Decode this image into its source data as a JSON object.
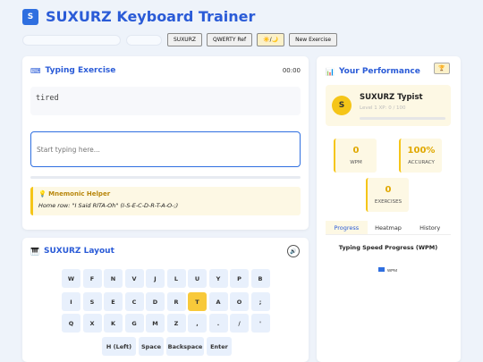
{
  "header": {
    "logo_letter": "S",
    "title": "SUXURZ Keyboard Trainer"
  },
  "toolbar": {
    "buttons": [
      "SUXURZ",
      "QWERTY Ref",
      "☀️/🌙",
      "New Exercise"
    ]
  },
  "exercise": {
    "icon": "keyboard-icon",
    "title": "Typing Exercise",
    "timer": "00:00",
    "text": "tired",
    "input_value": "",
    "input_placeholder": "Start typing here...",
    "progress": 0,
    "mnemonic_title": "Mnemonic Helper",
    "mnemonic_text": "Home row: \"I Said RITA-Oh\" (I-S-E-C-D-R-T-A-O-;)"
  },
  "layout": {
    "icon": "piano-icon",
    "title": "SUXURZ Layout",
    "sound_icon": "speaker-icon",
    "rows": [
      [
        "W",
        "F",
        "N",
        "V",
        "J",
        "L",
        "U",
        "Y",
        "P",
        "B"
      ],
      [
        "I",
        "S",
        "E",
        "C",
        "D",
        "R",
        "T",
        "A",
        "O",
        ";"
      ],
      [
        "Q",
        "X",
        "K",
        "G",
        "M",
        "Z",
        ",",
        ".",
        "/",
        "'"
      ],
      [
        "H (Left)",
        "Space",
        "Backspace",
        "Enter"
      ]
    ],
    "active_key": "T"
  },
  "performance": {
    "icon": "chart-icon",
    "title": "Your Performance",
    "trophy_icon": "trophy-icon",
    "avatar_letter": "S",
    "name": "SUXURZ Typist",
    "level_text": "Level 1 XP: 0 / 100",
    "xp_progress": 0,
    "stats": [
      {
        "value": "0",
        "label": "WPM"
      },
      {
        "value": "100%",
        "label": "ACCURACY"
      },
      {
        "value": "0",
        "label": "EXERCISES"
      }
    ],
    "tabs": [
      "Progress",
      "Heatmap",
      "History"
    ],
    "active_tab": "Progress"
  },
  "chart_data": {
    "type": "line",
    "title": "Typing Speed Progress (WPM)",
    "series": [
      {
        "name": "WPM",
        "values": []
      }
    ],
    "categories": [],
    "yticks": [
      "1.0",
      "0.8",
      "0.6",
      "0.4",
      "0.2",
      "0"
    ],
    "ylim": [
      0,
      1
    ],
    "legend": "top",
    "color": "#2f6fe0"
  }
}
